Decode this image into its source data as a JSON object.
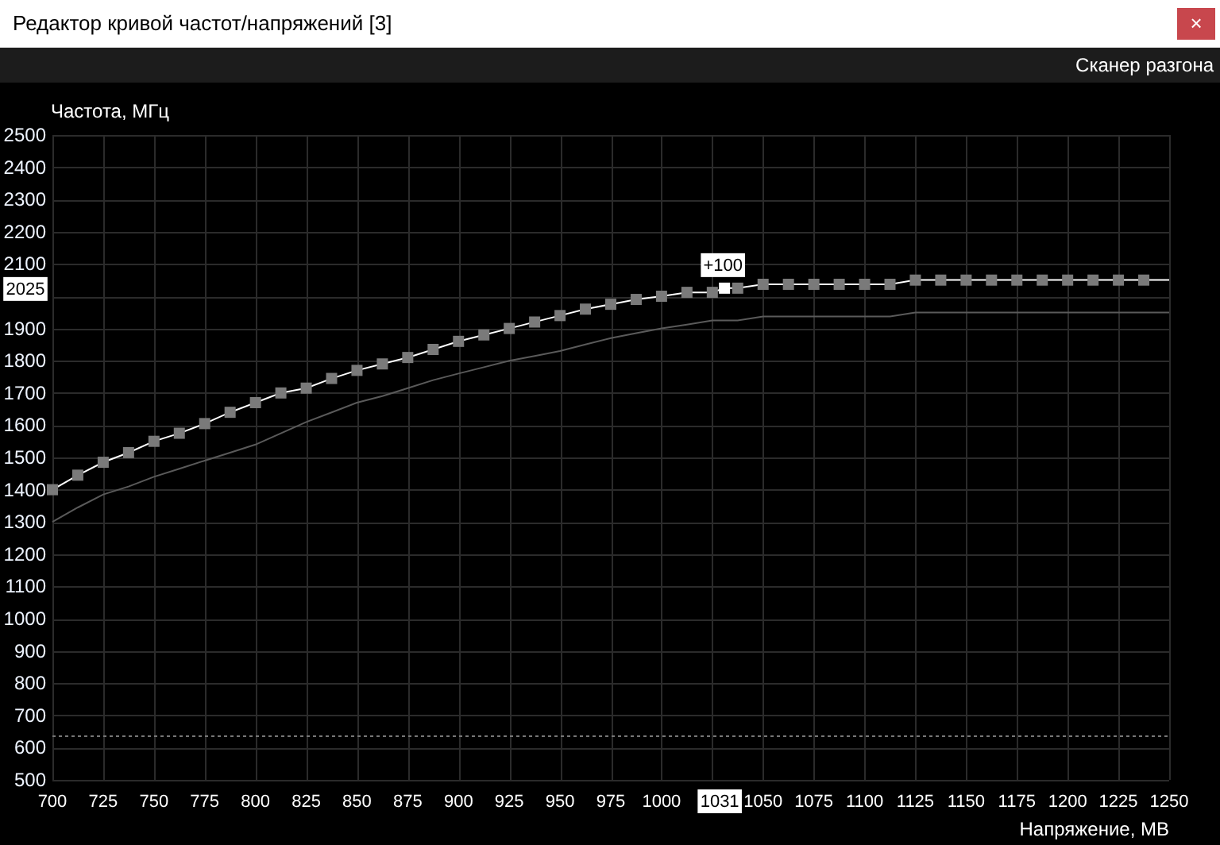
{
  "window": {
    "title": "Редактор кривой частот/напряжений [3]",
    "close_button": "×"
  },
  "toolbar": {
    "button": "Сканер разгона"
  },
  "cursor": {
    "voltage": "1031",
    "frequency": "2025"
  },
  "chart_data": {
    "type": "line",
    "xlabel": "Напряжение, МВ",
    "ylabel": "Частота, МГц",
    "xlim": [
      700,
      1250
    ],
    "ylim": [
      500,
      2500
    ],
    "xticks": [
      700,
      725,
      750,
      775,
      800,
      825,
      850,
      875,
      900,
      925,
      950,
      975,
      1000,
      1050,
      1075,
      1100,
      1125,
      1150,
      1175,
      1200,
      1225,
      1250
    ],
    "yticks": [
      500,
      600,
      700,
      800,
      900,
      1000,
      1100,
      1200,
      1300,
      1400,
      1500,
      1600,
      1700,
      1800,
      1900,
      2100,
      2200,
      2300,
      2400,
      2500
    ],
    "x": [
      700,
      712.5,
      725,
      737.5,
      750,
      762.5,
      775,
      787.5,
      800,
      812.5,
      825,
      837.5,
      850,
      862.5,
      875,
      887.5,
      900,
      912.5,
      925,
      937.5,
      950,
      962.5,
      975,
      987.5,
      1000,
      1012.5,
      1025,
      1031,
      1037.5,
      1050,
      1062.5,
      1075,
      1087.5,
      1100,
      1112.5,
      1125,
      1137.5,
      1150,
      1162.5,
      1175,
      1187.5,
      1200,
      1212.5,
      1225,
      1237.5,
      1250
    ],
    "series": [
      {
        "color": "#ffffff",
        "marker": "square",
        "values": [
          1400,
          1445,
          1485,
          1515,
          1550,
          1575,
          1605,
          1640,
          1670,
          1700,
          1715,
          1745,
          1770,
          1790,
          1810,
          1835,
          1860,
          1880,
          1900,
          1920,
          1940,
          1960,
          1975,
          1990,
          2000,
          2012,
          2012,
          2025,
          2025,
          2037,
          2037,
          2037,
          2037,
          2037,
          2037,
          2050,
          2050,
          2050,
          2050,
          2050,
          2050,
          2050,
          2050,
          2050,
          2050,
          2050
        ]
      },
      {
        "color": "#5a5a5a",
        "values": [
          1300,
          1345,
          1385,
          1410,
          1440,
          1465,
          1490,
          1515,
          1540,
          1575,
          1610,
          1640,
          1670,
          1690,
          1715,
          1740,
          1760,
          1780,
          1800,
          1815,
          1830,
          1850,
          1870,
          1885,
          1900,
          1912,
          1925,
          1925,
          1925,
          1937,
          1937,
          1937,
          1937,
          1937,
          1937,
          1950,
          1950,
          1950,
          1950,
          1950,
          1950,
          1950,
          1950,
          1950,
          1950,
          1950
        ]
      }
    ],
    "annotations": [
      {
        "x": 1031,
        "y": 2025,
        "text": "+100"
      }
    ],
    "ref_lines": [
      {
        "axis": "y",
        "value": 640
      }
    ],
    "grid": true
  }
}
